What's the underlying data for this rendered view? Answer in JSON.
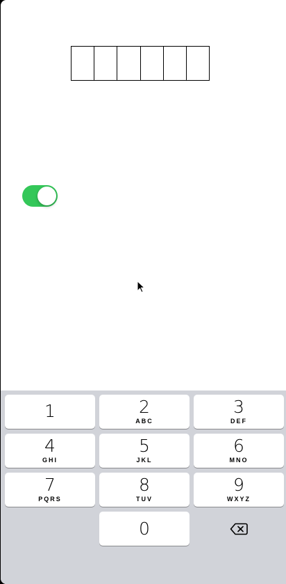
{
  "verification": {
    "code_cells": [
      "",
      "",
      "",
      "",
      "",
      ""
    ]
  },
  "toggle": {
    "state": "on",
    "color": "#34c759"
  },
  "keypad": {
    "background": "#d1d3d9",
    "keys": [
      {
        "digit": "1",
        "letters": ""
      },
      {
        "digit": "2",
        "letters": "ABC"
      },
      {
        "digit": "3",
        "letters": "DEF"
      },
      {
        "digit": "4",
        "letters": "GHI"
      },
      {
        "digit": "5",
        "letters": "JKL"
      },
      {
        "digit": "6",
        "letters": "MNO"
      },
      {
        "digit": "7",
        "letters": "PQRS"
      },
      {
        "digit": "8",
        "letters": "TUV"
      },
      {
        "digit": "9",
        "letters": "WXYZ"
      },
      {
        "digit": "0",
        "letters": ""
      }
    ],
    "delete_icon": "backspace-icon"
  }
}
